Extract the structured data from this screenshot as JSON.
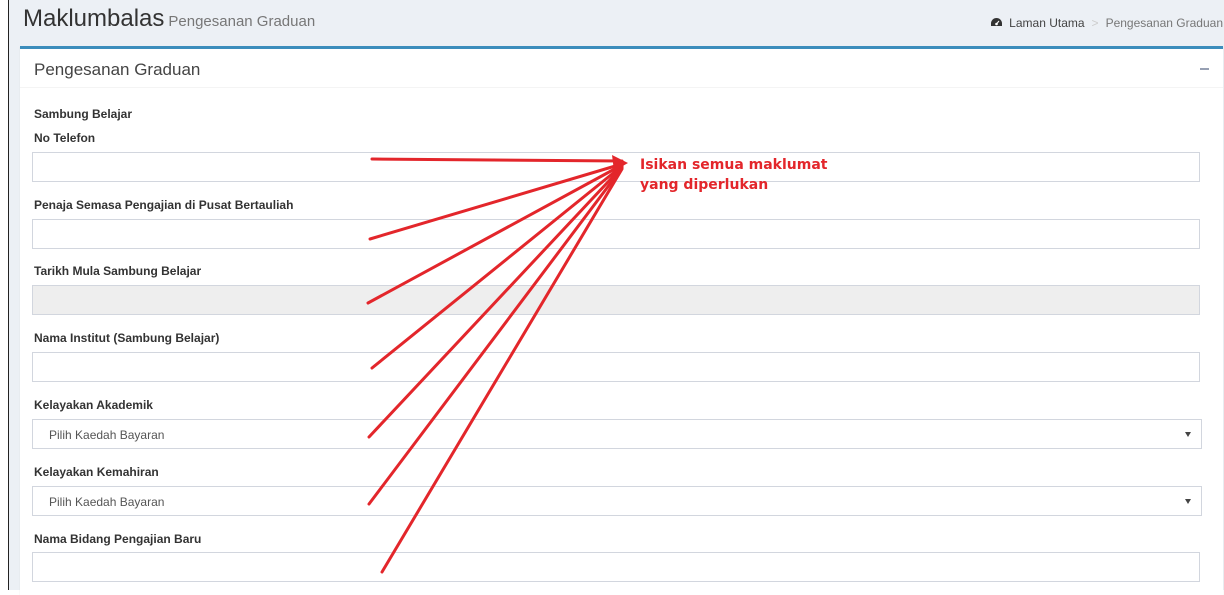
{
  "header": {
    "title": "Maklumbalas",
    "subtitle": "Pengesanan Graduan",
    "breadcrumb": {
      "home": "Laman Utama",
      "current": "Pengesanan Graduan"
    }
  },
  "box": {
    "title": "Pengesanan Graduan",
    "section_label": "Sambung Belajar",
    "fields": {
      "phone": {
        "label": "No Telefon",
        "value": ""
      },
      "sponsor": {
        "label": "Penaja Semasa Pengajian di Pusat Bertauliah",
        "value": ""
      },
      "start_date": {
        "label": "Tarikh Mula Sambung Belajar",
        "value": ""
      },
      "institute": {
        "label": "Nama Institut (Sambung Belajar)",
        "value": ""
      },
      "academic": {
        "label": "Kelayakan Akademik",
        "selected": "Pilih Kaedah Bayaran"
      },
      "skill": {
        "label": "Kelayakan Kemahiran",
        "selected": "Pilih Kaedah Bayaran"
      },
      "new_field": {
        "label": "Nama Bidang Pengajian Baru",
        "value": ""
      }
    }
  },
  "annotation": {
    "line1": "Isikan semua maklumat",
    "line2": "yang diperlukan",
    "color": "#e3262b"
  },
  "colors": {
    "accent": "#3c8dbc",
    "page_bg": "#ecf0f5",
    "disabled_bg": "#eeeeee",
    "annotation_red": "#e3262b"
  },
  "icons": {
    "home": "dashboard-icon",
    "collapse": "minus-icon",
    "select_caret": "caret-down-icon"
  }
}
